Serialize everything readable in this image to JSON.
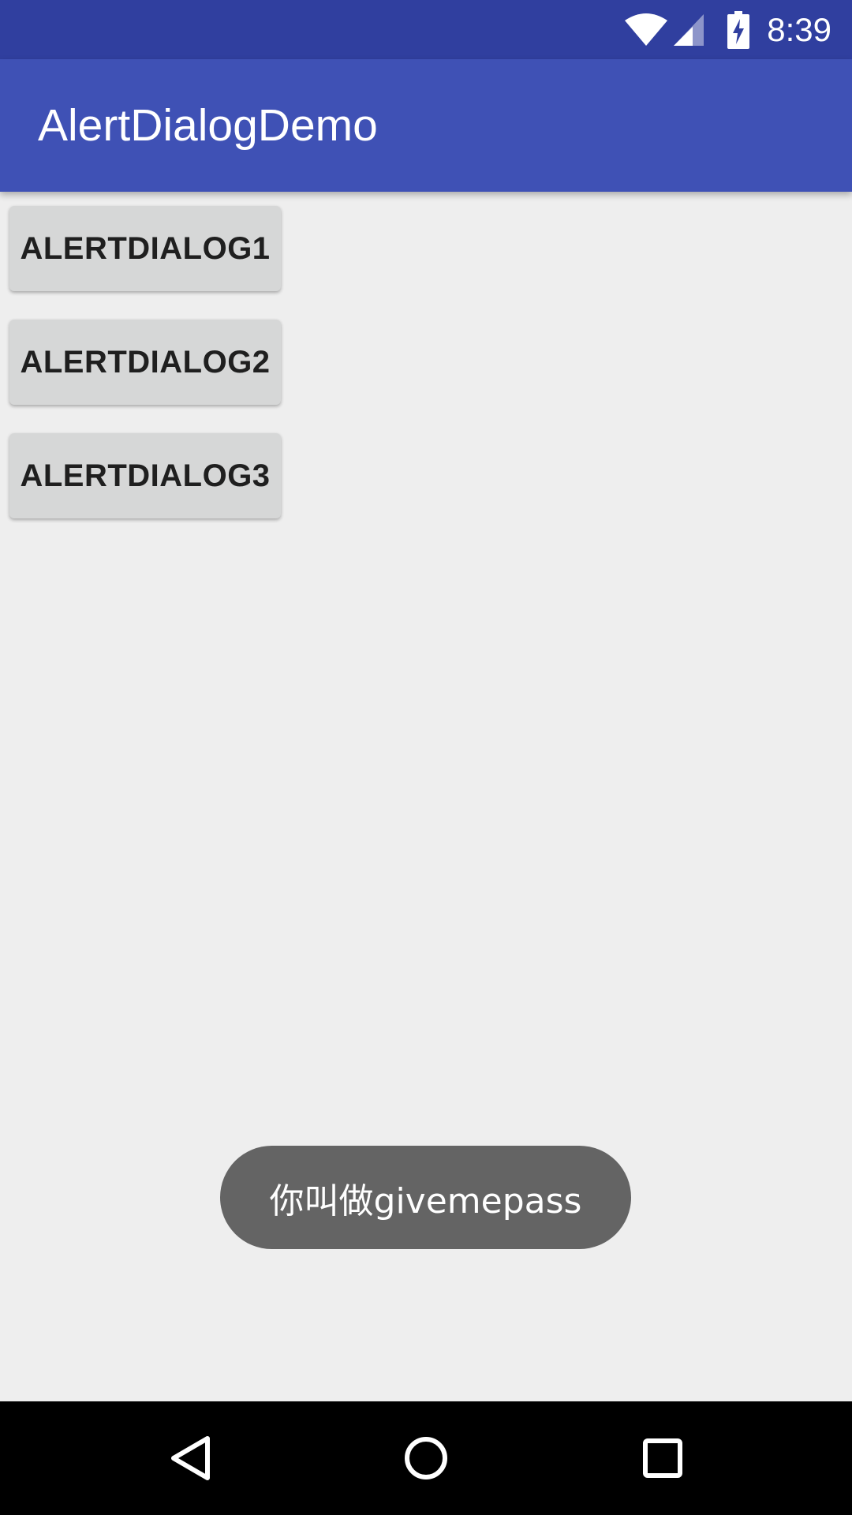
{
  "status_bar": {
    "time": "8:39",
    "icons": [
      "wifi-icon",
      "signal-icon",
      "battery-charging-icon"
    ]
  },
  "app_bar": {
    "title": "AlertDialogDemo"
  },
  "buttons": [
    {
      "label": "ALERTDIALOG1"
    },
    {
      "label": "ALERTDIALOG2"
    },
    {
      "label": "ALERTDIALOG3"
    }
  ],
  "toast": {
    "text": "你叫做givemepass"
  },
  "nav_bar": {
    "icons": [
      "back-icon",
      "home-icon",
      "recents-icon"
    ]
  },
  "colors": {
    "status_bar": "#303f9f",
    "app_bar": "#3f51b5",
    "background": "#eeeeee",
    "button": "#d6d7d7",
    "toast": "#646464",
    "nav_bar": "#000000"
  }
}
